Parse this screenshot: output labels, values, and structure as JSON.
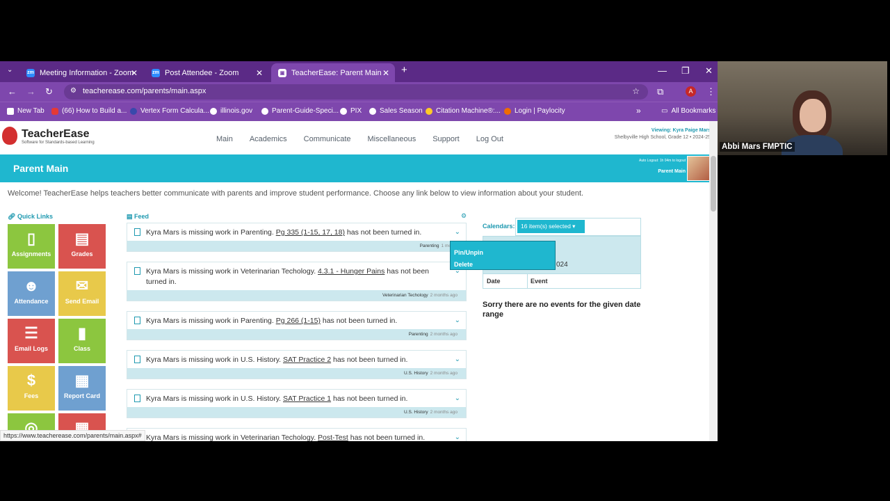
{
  "browser": {
    "tabs": [
      {
        "title": "Meeting Information - Zoom",
        "icon": "zm"
      },
      {
        "title": "Post Attendee - Zoom",
        "icon": "zm"
      },
      {
        "title": "TeacherEase: Parent Main",
        "icon": "te"
      }
    ],
    "url": "teacherease.com/parents/main.aspx",
    "profile_initial": "A",
    "bookmarks": [
      "New Tab",
      "(66) How to Build a...",
      "Vertex Form Calcula...",
      "illinois.gov",
      "Parent-Guide-Speci...",
      "PIX",
      "Sales Season",
      "Citation Machine®:...",
      "Login | Paylocity"
    ],
    "all_bookmarks": "All Bookmarks",
    "status_url": "https://www.teacherease.com/parents/main.aspx#"
  },
  "site": {
    "logo_title": "TeacherEase",
    "logo_subtitle": "Software for Standards-based Learning",
    "menu": [
      "Main",
      "Academics",
      "Communicate",
      "Miscellaneous",
      "Support",
      "Log Out"
    ],
    "viewing": "Viewing: Kyra Paige Mars",
    "school": "Shelbyville High School, Grade 12 • 2024-25",
    "banner_title": "Parent Main",
    "auto_logout": "Auto Logout: 1h 04m to logout",
    "banner_sub": "Parent Main",
    "welcome": "Welcome! TeacherEase helps teachers better communicate with parents and improve student performance. Choose any link below to view information about your student.",
    "quick_links_title": "Quick Links",
    "quick_links": [
      "Assignments",
      "Grades",
      "Attendance",
      "Send Email",
      "Email Logs",
      "Class",
      "Fees",
      "Report Card"
    ],
    "feed_title": "Feed",
    "feed": [
      {
        "pre": "Kyra Mars is missing work in Parenting. ",
        "link": "Pg 335 (1-15, 17, 18)",
        "post": " has not been turned in.",
        "class": "Parenting",
        "ago": "1 month"
      },
      {
        "pre": "Kyra Mars is missing work in Veterinarian Techology. ",
        "link": "4.3.1 - Hunger Pains",
        "post": " has not been turned in.",
        "class": "Veterinarian Techology",
        "ago": "2 months ago"
      },
      {
        "pre": "Kyra Mars is missing work in Parenting. ",
        "link": "Pg 266 (1-15)",
        "post": " has not been turned in.",
        "class": "Parenting",
        "ago": "2 months ago"
      },
      {
        "pre": "Kyra Mars is missing work in U.S. History. ",
        "link": "SAT Practice 2",
        "post": " has not been turned in.",
        "class": "U.S. History",
        "ago": "2 months ago"
      },
      {
        "pre": "Kyra Mars is missing work in U.S. History. ",
        "link": "SAT Practice 1",
        "post": " has not been turned in.",
        "class": "U.S. History",
        "ago": "2 months ago"
      },
      {
        "pre": "Kyra Mars is missing work in Veterinarian Techology. ",
        "link": "Post-Test",
        "post": " has not been turned in.",
        "class": "",
        "ago": ""
      }
    ],
    "popup": [
      "Pin/Unpin",
      "Delete"
    ],
    "calendars_label": "Calendars:",
    "calendars_selected": "16 item(s) selected ▾",
    "cal_partial": "024",
    "cal_col_date": "Date",
    "cal_col_event": "Event",
    "no_events": "Sorry there are no events for the given date range"
  },
  "video": {
    "name": "Abbi Mars FMPTIC"
  },
  "colors": {
    "brand": "#1fb7cf",
    "tabbar": "#5b2a86",
    "toolbar": "#7e47ad"
  }
}
